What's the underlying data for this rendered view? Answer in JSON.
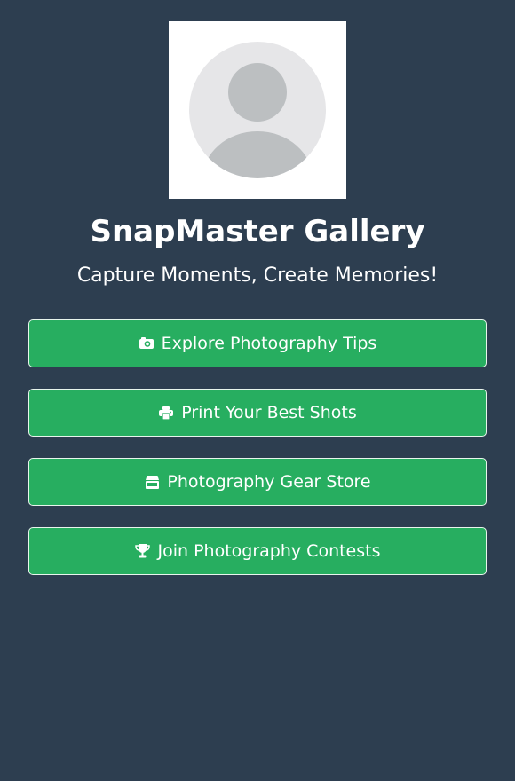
{
  "profile": {
    "avatar_alt": "Profile picture placeholder"
  },
  "header": {
    "title": "SnapMaster Gallery",
    "subtitle": "Capture Moments, Create Memories!"
  },
  "links": [
    {
      "label": "Explore Photography Tips",
      "icon": "camera-icon"
    },
    {
      "label": "Print Your Best Shots",
      "icon": "printer-icon"
    },
    {
      "label": "Photography Gear Store",
      "icon": "store-icon"
    },
    {
      "label": "Join Photography Contests",
      "icon": "trophy-icon"
    }
  ],
  "colors": {
    "background": "#2d3e50",
    "button": "#27ae60",
    "button_border": "#e8f5ec",
    "text": "#ffffff"
  }
}
